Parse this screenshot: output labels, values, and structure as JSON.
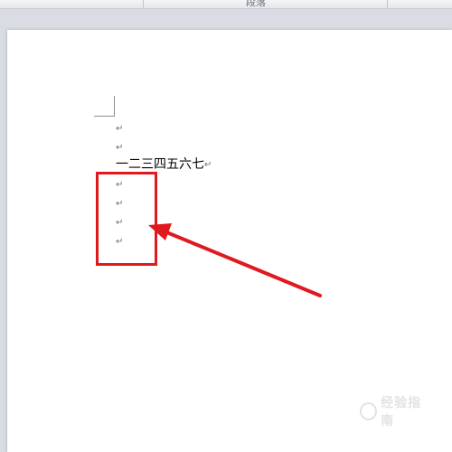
{
  "ribbon": {
    "group_label": "段落"
  },
  "document": {
    "paragraphs": [
      {
        "text": "",
        "mark": "↵"
      },
      {
        "text": "",
        "mark": "↵"
      },
      {
        "text": "一二三四五六七",
        "mark": "↵"
      },
      {
        "text": "",
        "mark": "↵"
      },
      {
        "text": "",
        "mark": "↵"
      },
      {
        "text": "",
        "mark": "↵"
      },
      {
        "text": "",
        "mark": "↵"
      }
    ]
  },
  "annotation": {
    "box_color": "#e0191f",
    "arrow_color": "#e0191f"
  },
  "watermark": {
    "text": "经验指南"
  }
}
